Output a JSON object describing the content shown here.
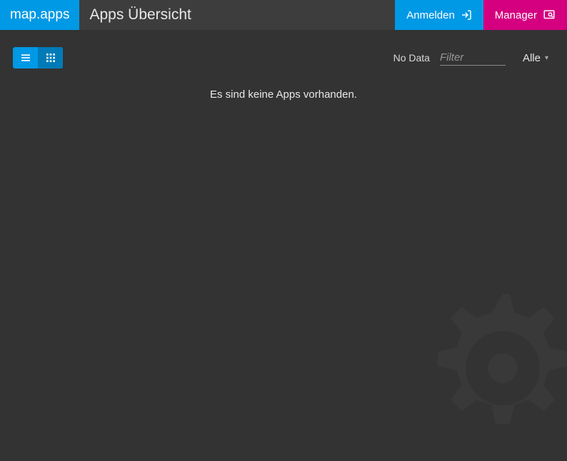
{
  "header": {
    "brand": "map.apps",
    "title": "Apps Übersicht",
    "login_label": "Anmelden",
    "manager_label": "Manager"
  },
  "toolbar": {
    "no_data_label": "No Data",
    "filter_placeholder": "Filter",
    "dropdown_selected": "Alle"
  },
  "main": {
    "empty_message": "Es sind keine Apps vorhanden."
  },
  "colors": {
    "accent": "#0099e5",
    "brand_pink": "#d4007f",
    "bg": "#333333",
    "header_bg": "#3d3d3d"
  }
}
